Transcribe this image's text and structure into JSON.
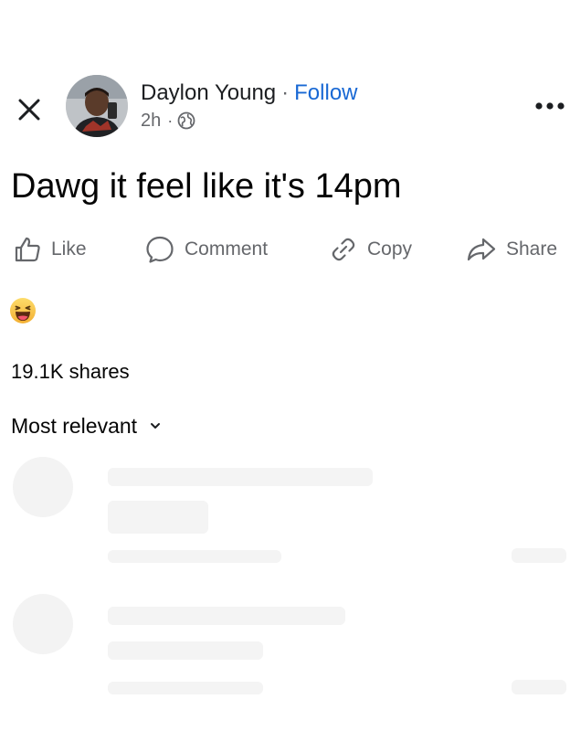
{
  "header": {
    "author_name": "Daylon Young",
    "separator": "·",
    "follow_label": "Follow",
    "timestamp": "2h",
    "meta_separator": "·",
    "privacy_icon": "globe-icon",
    "close_icon": "close-icon",
    "more_icon": "more-options-icon"
  },
  "post": {
    "text": "Dawg it feel like it's 14pm"
  },
  "actions": {
    "like_label": "Like",
    "comment_label": "Comment",
    "copy_label": "Copy",
    "share_label": "Share"
  },
  "reactions": {
    "emoji": "haha-reaction-icon"
  },
  "stats": {
    "shares": "19.1K shares"
  },
  "comments": {
    "sort_label": "Most relevant"
  },
  "colors": {
    "accent": "#1868d4",
    "secondary_text": "#65676b",
    "primary_text": "#050505",
    "reaction_yellow": "#f7c24a"
  }
}
